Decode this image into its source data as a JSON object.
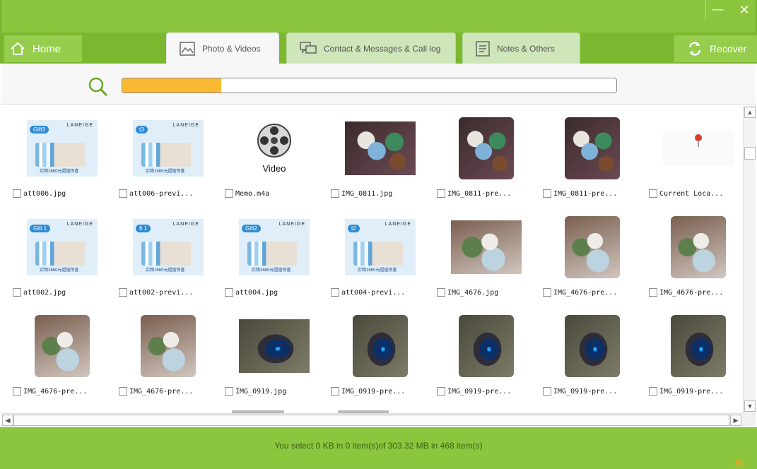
{
  "window": {
    "minimize_glyph": "—",
    "close_glyph": "✕"
  },
  "nav": {
    "home_label": "Home",
    "tabs": [
      {
        "label": "Photo & Videos",
        "icon": "picture-icon",
        "active": true
      },
      {
        "label": "Contact & Messages & Call log",
        "icon": "chat-icon",
        "active": false
      },
      {
        "label": "Notes & Others",
        "icon": "notes-icon",
        "active": false
      }
    ],
    "recover_label": "Recover"
  },
  "scan": {
    "progress_fraction": 0.2
  },
  "grid": {
    "items": [
      {
        "name": "att006.jpg",
        "kind": "cosmetic",
        "badge": "Gift3"
      },
      {
        "name": "att006-previ...",
        "kind": "cosmetic",
        "badge": "t3"
      },
      {
        "name": "Memo.m4a",
        "kind": "video",
        "video_label": "Video"
      },
      {
        "name": "IMG_0811.jpg",
        "kind": "cups"
      },
      {
        "name": "IMG_0811-pre...",
        "kind": "cups"
      },
      {
        "name": "IMG_0811-pre...",
        "kind": "cups"
      },
      {
        "name": "Current Loca...",
        "kind": "location"
      },
      {
        "name": "att002.jpg",
        "kind": "cosmetic",
        "badge": "Gift 1"
      },
      {
        "name": "att002-previ...",
        "kind": "cosmetic",
        "badge": "ft 1"
      },
      {
        "name": "att004.jpg",
        "kind": "cosmetic",
        "badge": "Gift2"
      },
      {
        "name": "att004-previ...",
        "kind": "cosmetic",
        "badge": "t2"
      },
      {
        "name": "IMG_4676.jpg",
        "kind": "green-cups"
      },
      {
        "name": "IMG_4676-pre...",
        "kind": "green-cups"
      },
      {
        "name": "IMG_4676-pre...",
        "kind": "green-cups"
      },
      {
        "name": "IMG_4676-pre...",
        "kind": "green-cups"
      },
      {
        "name": "IMG_4676-pre...",
        "kind": "green-cups"
      },
      {
        "name": "IMG_0919.jpg",
        "kind": "mouse"
      },
      {
        "name": "IMG_0919-pre...",
        "kind": "mouse"
      },
      {
        "name": "IMG_0919-pre...",
        "kind": "mouse"
      },
      {
        "name": "IMG_0919-pre...",
        "kind": "mouse"
      },
      {
        "name": "IMG_0919-pre...",
        "kind": "mouse"
      }
    ],
    "cosmetic_brand": "LANEIGE",
    "cosmetic_text": "实物1680元超值惊喜"
  },
  "status": {
    "text": "You select 0 KB in 0 item(s)of 303.32 MB in 468 item(s)"
  },
  "colors": {
    "accent": "#8cc63f",
    "progress": "#f9b933"
  }
}
